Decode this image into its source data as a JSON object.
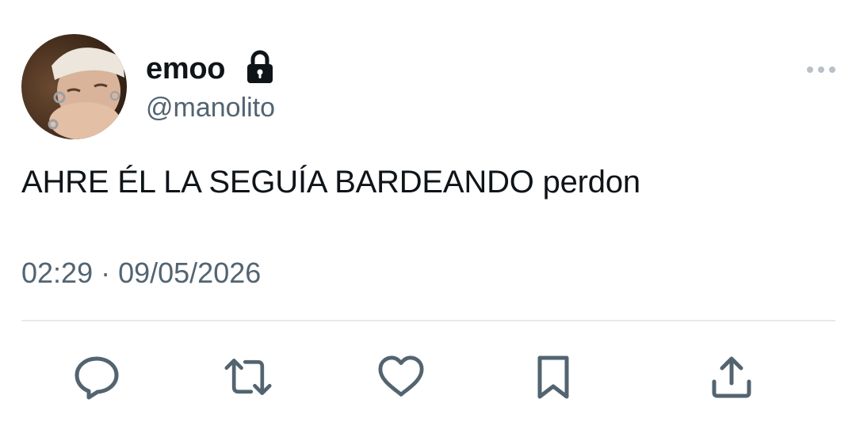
{
  "tweet": {
    "display_name": "emoo",
    "handle": "@manolito",
    "text": "AHRE ÉL LA SEGUÍA BARDEANDO perdon",
    "timestamp": "02:29 · 09/05/2026",
    "protected_icon": "lock-icon",
    "avatar": "profile-photo"
  },
  "actions": [
    {
      "name": "reply",
      "icon": "reply-icon"
    },
    {
      "name": "retweet",
      "icon": "retweet-icon"
    },
    {
      "name": "like",
      "icon": "heart-icon"
    },
    {
      "name": "bookmark",
      "icon": "bookmark-icon"
    },
    {
      "name": "share",
      "icon": "share-icon"
    }
  ],
  "colors": {
    "primary_text": "#0f1419",
    "secondary_text": "#536471",
    "icon": "#536471",
    "divider": "#e6eaed"
  }
}
